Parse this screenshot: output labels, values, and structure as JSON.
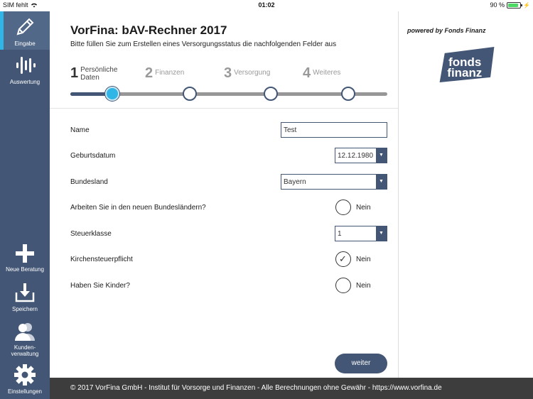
{
  "status_bar": {
    "carrier": "SIM fehlt",
    "time": "01:02",
    "battery": "90 %",
    "battery_level": 0.9
  },
  "sidebar": {
    "items": [
      {
        "label": "Eingabe",
        "icon": "pencil-icon",
        "active": true
      },
      {
        "label": "Auswertung",
        "icon": "waveform-icon",
        "active": false
      },
      {
        "label": "Neue Beratung",
        "icon": "plus-icon",
        "active": false
      },
      {
        "label": "Speichern",
        "icon": "download-icon",
        "active": false
      },
      {
        "label_line1": "Kunden-",
        "label_line2": "verwaltung",
        "icon": "users-icon",
        "active": false
      },
      {
        "label": "Einstellungen",
        "icon": "gear-icon",
        "active": false
      }
    ]
  },
  "header": {
    "title": "VorFina: bAV-Rechner 2017",
    "subtitle": "Bitte füllen Sie zum Erstellen eines Versorgungsstatus die nachfolgenden Felder aus"
  },
  "steps": [
    {
      "num": "1",
      "name_line1": "Persönliche",
      "name_line2": "Daten",
      "active": true
    },
    {
      "num": "2",
      "name_line1": "Finanzen",
      "active": false
    },
    {
      "num": "3",
      "name_line1": "Versorgung",
      "active": false
    },
    {
      "num": "4",
      "name_line1": "Weiteres",
      "active": false
    }
  ],
  "form": {
    "name": {
      "label": "Name",
      "value": "Test"
    },
    "birthdate": {
      "label": "Geburtsdatum",
      "value": "12.12.1980"
    },
    "state": {
      "label": "Bundesland",
      "value": "Bayern"
    },
    "new_states": {
      "label": "Arbeiten Sie in den neuen Bundesländern?",
      "option": "Nein",
      "checked": false
    },
    "tax_class": {
      "label": "Steuerklasse",
      "value": "1"
    },
    "church_tax": {
      "label": "Kirchensteuerpflicht",
      "option": "Nein",
      "checked": true
    },
    "children": {
      "label": "Haben Sie Kinder?",
      "option": "Nein",
      "checked": false
    }
  },
  "buttons": {
    "next": "weiter"
  },
  "right_panel": {
    "powered_by": "powered by Fonds Finanz",
    "logo_line1": "fonds",
    "logo_line2": "finanz"
  },
  "footer": {
    "text": "© 2017 VorFina GmbH - Institut für Vorsorge und Finanzen - Alle Berechnungen ohne Gewähr - https://www.vorfina.de"
  },
  "colors": {
    "sidebar": "#435675",
    "accent": "#2fb5e6",
    "footer": "#3d3d3d"
  }
}
